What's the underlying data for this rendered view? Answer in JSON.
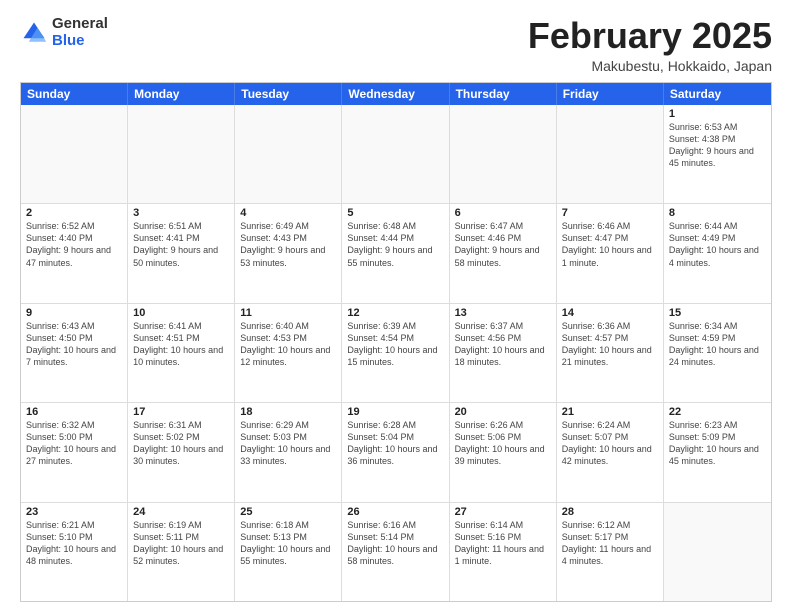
{
  "logo": {
    "general": "General",
    "blue": "Blue"
  },
  "title": {
    "month": "February 2025",
    "location": "Makubestu, Hokkaido, Japan"
  },
  "header": {
    "days": [
      "Sunday",
      "Monday",
      "Tuesday",
      "Wednesday",
      "Thursday",
      "Friday",
      "Saturday"
    ]
  },
  "weeks": [
    [
      {
        "day": "",
        "info": ""
      },
      {
        "day": "",
        "info": ""
      },
      {
        "day": "",
        "info": ""
      },
      {
        "day": "",
        "info": ""
      },
      {
        "day": "",
        "info": ""
      },
      {
        "day": "",
        "info": ""
      },
      {
        "day": "1",
        "info": "Sunrise: 6:53 AM\nSunset: 4:38 PM\nDaylight: 9 hours and 45 minutes."
      }
    ],
    [
      {
        "day": "2",
        "info": "Sunrise: 6:52 AM\nSunset: 4:40 PM\nDaylight: 9 hours and 47 minutes."
      },
      {
        "day": "3",
        "info": "Sunrise: 6:51 AM\nSunset: 4:41 PM\nDaylight: 9 hours and 50 minutes."
      },
      {
        "day": "4",
        "info": "Sunrise: 6:49 AM\nSunset: 4:43 PM\nDaylight: 9 hours and 53 minutes."
      },
      {
        "day": "5",
        "info": "Sunrise: 6:48 AM\nSunset: 4:44 PM\nDaylight: 9 hours and 55 minutes."
      },
      {
        "day": "6",
        "info": "Sunrise: 6:47 AM\nSunset: 4:46 PM\nDaylight: 9 hours and 58 minutes."
      },
      {
        "day": "7",
        "info": "Sunrise: 6:46 AM\nSunset: 4:47 PM\nDaylight: 10 hours and 1 minute."
      },
      {
        "day": "8",
        "info": "Sunrise: 6:44 AM\nSunset: 4:49 PM\nDaylight: 10 hours and 4 minutes."
      }
    ],
    [
      {
        "day": "9",
        "info": "Sunrise: 6:43 AM\nSunset: 4:50 PM\nDaylight: 10 hours and 7 minutes."
      },
      {
        "day": "10",
        "info": "Sunrise: 6:41 AM\nSunset: 4:51 PM\nDaylight: 10 hours and 10 minutes."
      },
      {
        "day": "11",
        "info": "Sunrise: 6:40 AM\nSunset: 4:53 PM\nDaylight: 10 hours and 12 minutes."
      },
      {
        "day": "12",
        "info": "Sunrise: 6:39 AM\nSunset: 4:54 PM\nDaylight: 10 hours and 15 minutes."
      },
      {
        "day": "13",
        "info": "Sunrise: 6:37 AM\nSunset: 4:56 PM\nDaylight: 10 hours and 18 minutes."
      },
      {
        "day": "14",
        "info": "Sunrise: 6:36 AM\nSunset: 4:57 PM\nDaylight: 10 hours and 21 minutes."
      },
      {
        "day": "15",
        "info": "Sunrise: 6:34 AM\nSunset: 4:59 PM\nDaylight: 10 hours and 24 minutes."
      }
    ],
    [
      {
        "day": "16",
        "info": "Sunrise: 6:32 AM\nSunset: 5:00 PM\nDaylight: 10 hours and 27 minutes."
      },
      {
        "day": "17",
        "info": "Sunrise: 6:31 AM\nSunset: 5:02 PM\nDaylight: 10 hours and 30 minutes."
      },
      {
        "day": "18",
        "info": "Sunrise: 6:29 AM\nSunset: 5:03 PM\nDaylight: 10 hours and 33 minutes."
      },
      {
        "day": "19",
        "info": "Sunrise: 6:28 AM\nSunset: 5:04 PM\nDaylight: 10 hours and 36 minutes."
      },
      {
        "day": "20",
        "info": "Sunrise: 6:26 AM\nSunset: 5:06 PM\nDaylight: 10 hours and 39 minutes."
      },
      {
        "day": "21",
        "info": "Sunrise: 6:24 AM\nSunset: 5:07 PM\nDaylight: 10 hours and 42 minutes."
      },
      {
        "day": "22",
        "info": "Sunrise: 6:23 AM\nSunset: 5:09 PM\nDaylight: 10 hours and 45 minutes."
      }
    ],
    [
      {
        "day": "23",
        "info": "Sunrise: 6:21 AM\nSunset: 5:10 PM\nDaylight: 10 hours and 48 minutes."
      },
      {
        "day": "24",
        "info": "Sunrise: 6:19 AM\nSunset: 5:11 PM\nDaylight: 10 hours and 52 minutes."
      },
      {
        "day": "25",
        "info": "Sunrise: 6:18 AM\nSunset: 5:13 PM\nDaylight: 10 hours and 55 minutes."
      },
      {
        "day": "26",
        "info": "Sunrise: 6:16 AM\nSunset: 5:14 PM\nDaylight: 10 hours and 58 minutes."
      },
      {
        "day": "27",
        "info": "Sunrise: 6:14 AM\nSunset: 5:16 PM\nDaylight: 11 hours and 1 minute."
      },
      {
        "day": "28",
        "info": "Sunrise: 6:12 AM\nSunset: 5:17 PM\nDaylight: 11 hours and 4 minutes."
      },
      {
        "day": "",
        "info": ""
      }
    ]
  ]
}
